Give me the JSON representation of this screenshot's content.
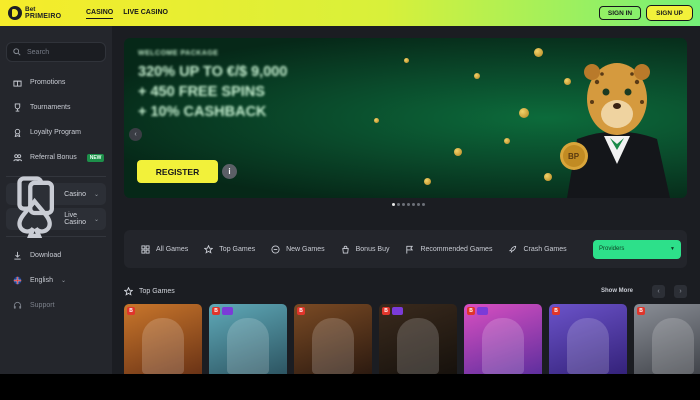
{
  "brand": {
    "line1": "Bet",
    "line2": "PRIMEIRO"
  },
  "nav": [
    {
      "label": "CASINO",
      "active": true
    },
    {
      "label": "LIVE CASINO",
      "active": false
    }
  ],
  "header": {
    "signin_label": "SIGN IN",
    "signup_label": "SIGN UP"
  },
  "sidebar": {
    "search_placeholder": "Search",
    "items": [
      {
        "label": "Promotions",
        "icon": "gift-icon"
      },
      {
        "label": "Tournaments",
        "icon": "trophy-icon"
      },
      {
        "label": "Loyalty Program",
        "icon": "medal-icon"
      },
      {
        "label": "Referral Bonus",
        "icon": "users-icon",
        "badge": "NEW"
      }
    ],
    "groups": [
      {
        "label": "Casino",
        "icon": "cards-icon"
      },
      {
        "label": "Live Casino",
        "icon": "spade-icon"
      }
    ],
    "footer": [
      {
        "label": "Download",
        "icon": "download-icon"
      },
      {
        "label": "English",
        "icon": "flag-uk-icon"
      },
      {
        "label": "Support",
        "icon": "headset-icon"
      }
    ]
  },
  "banner": {
    "small": "WELCOME PACKAGE",
    "line1": "320% UP TO €/$ 9,000",
    "line2": "+ 450 FREE SPINS",
    "line3": "+ 10% CASHBACK",
    "register_label": "REGISTER",
    "info_label": "i",
    "coin_text": "BP",
    "slides": 7,
    "active_slide": 1
  },
  "filters": [
    {
      "label": "All Games",
      "icon": "grid-icon"
    },
    {
      "label": "Top Games",
      "icon": "star-icon"
    },
    {
      "label": "New Games",
      "icon": "new-icon"
    },
    {
      "label": "Bonus Buy",
      "icon": "bag-icon"
    },
    {
      "label": "Recommended Games",
      "icon": "flag-icon"
    },
    {
      "label": "Crash Games",
      "icon": "rocket-icon"
    }
  ],
  "providers_label": "Providers",
  "section": {
    "title": "Top Games",
    "show_more": "Show More"
  },
  "games": [
    {
      "name": "game-egypt",
      "colors": [
        "#c9762b",
        "#6a3316"
      ],
      "tag": "B"
    },
    {
      "name": "game-raccoon-explorer",
      "colors": [
        "#5fa9b8",
        "#2d5562"
      ],
      "tag": "B",
      "tag2": true
    },
    {
      "name": "game-cowboy",
      "colors": [
        "#7a4a24",
        "#2c1a10"
      ],
      "tag": "B"
    },
    {
      "name": "game-gangster",
      "colors": [
        "#3a2a1d",
        "#16110c"
      ],
      "tag": "B",
      "tag2": true
    },
    {
      "name": "game-clover",
      "colors": [
        "#d94fc1",
        "#5e2f9e"
      ],
      "tag": "B",
      "tag2": true
    },
    {
      "name": "game-lion",
      "colors": [
        "#6b53c9",
        "#34227a"
      ],
      "tag": "B"
    },
    {
      "name": "game-raccoon",
      "colors": [
        "#8a8e96",
        "#3d4046"
      ],
      "tag": "B"
    }
  ],
  "colors": {
    "accent_yellow": "#f2f13a",
    "accent_green": "#2de08a",
    "sidebar_bg": "#24262c",
    "main_bg": "#1b1d22"
  }
}
